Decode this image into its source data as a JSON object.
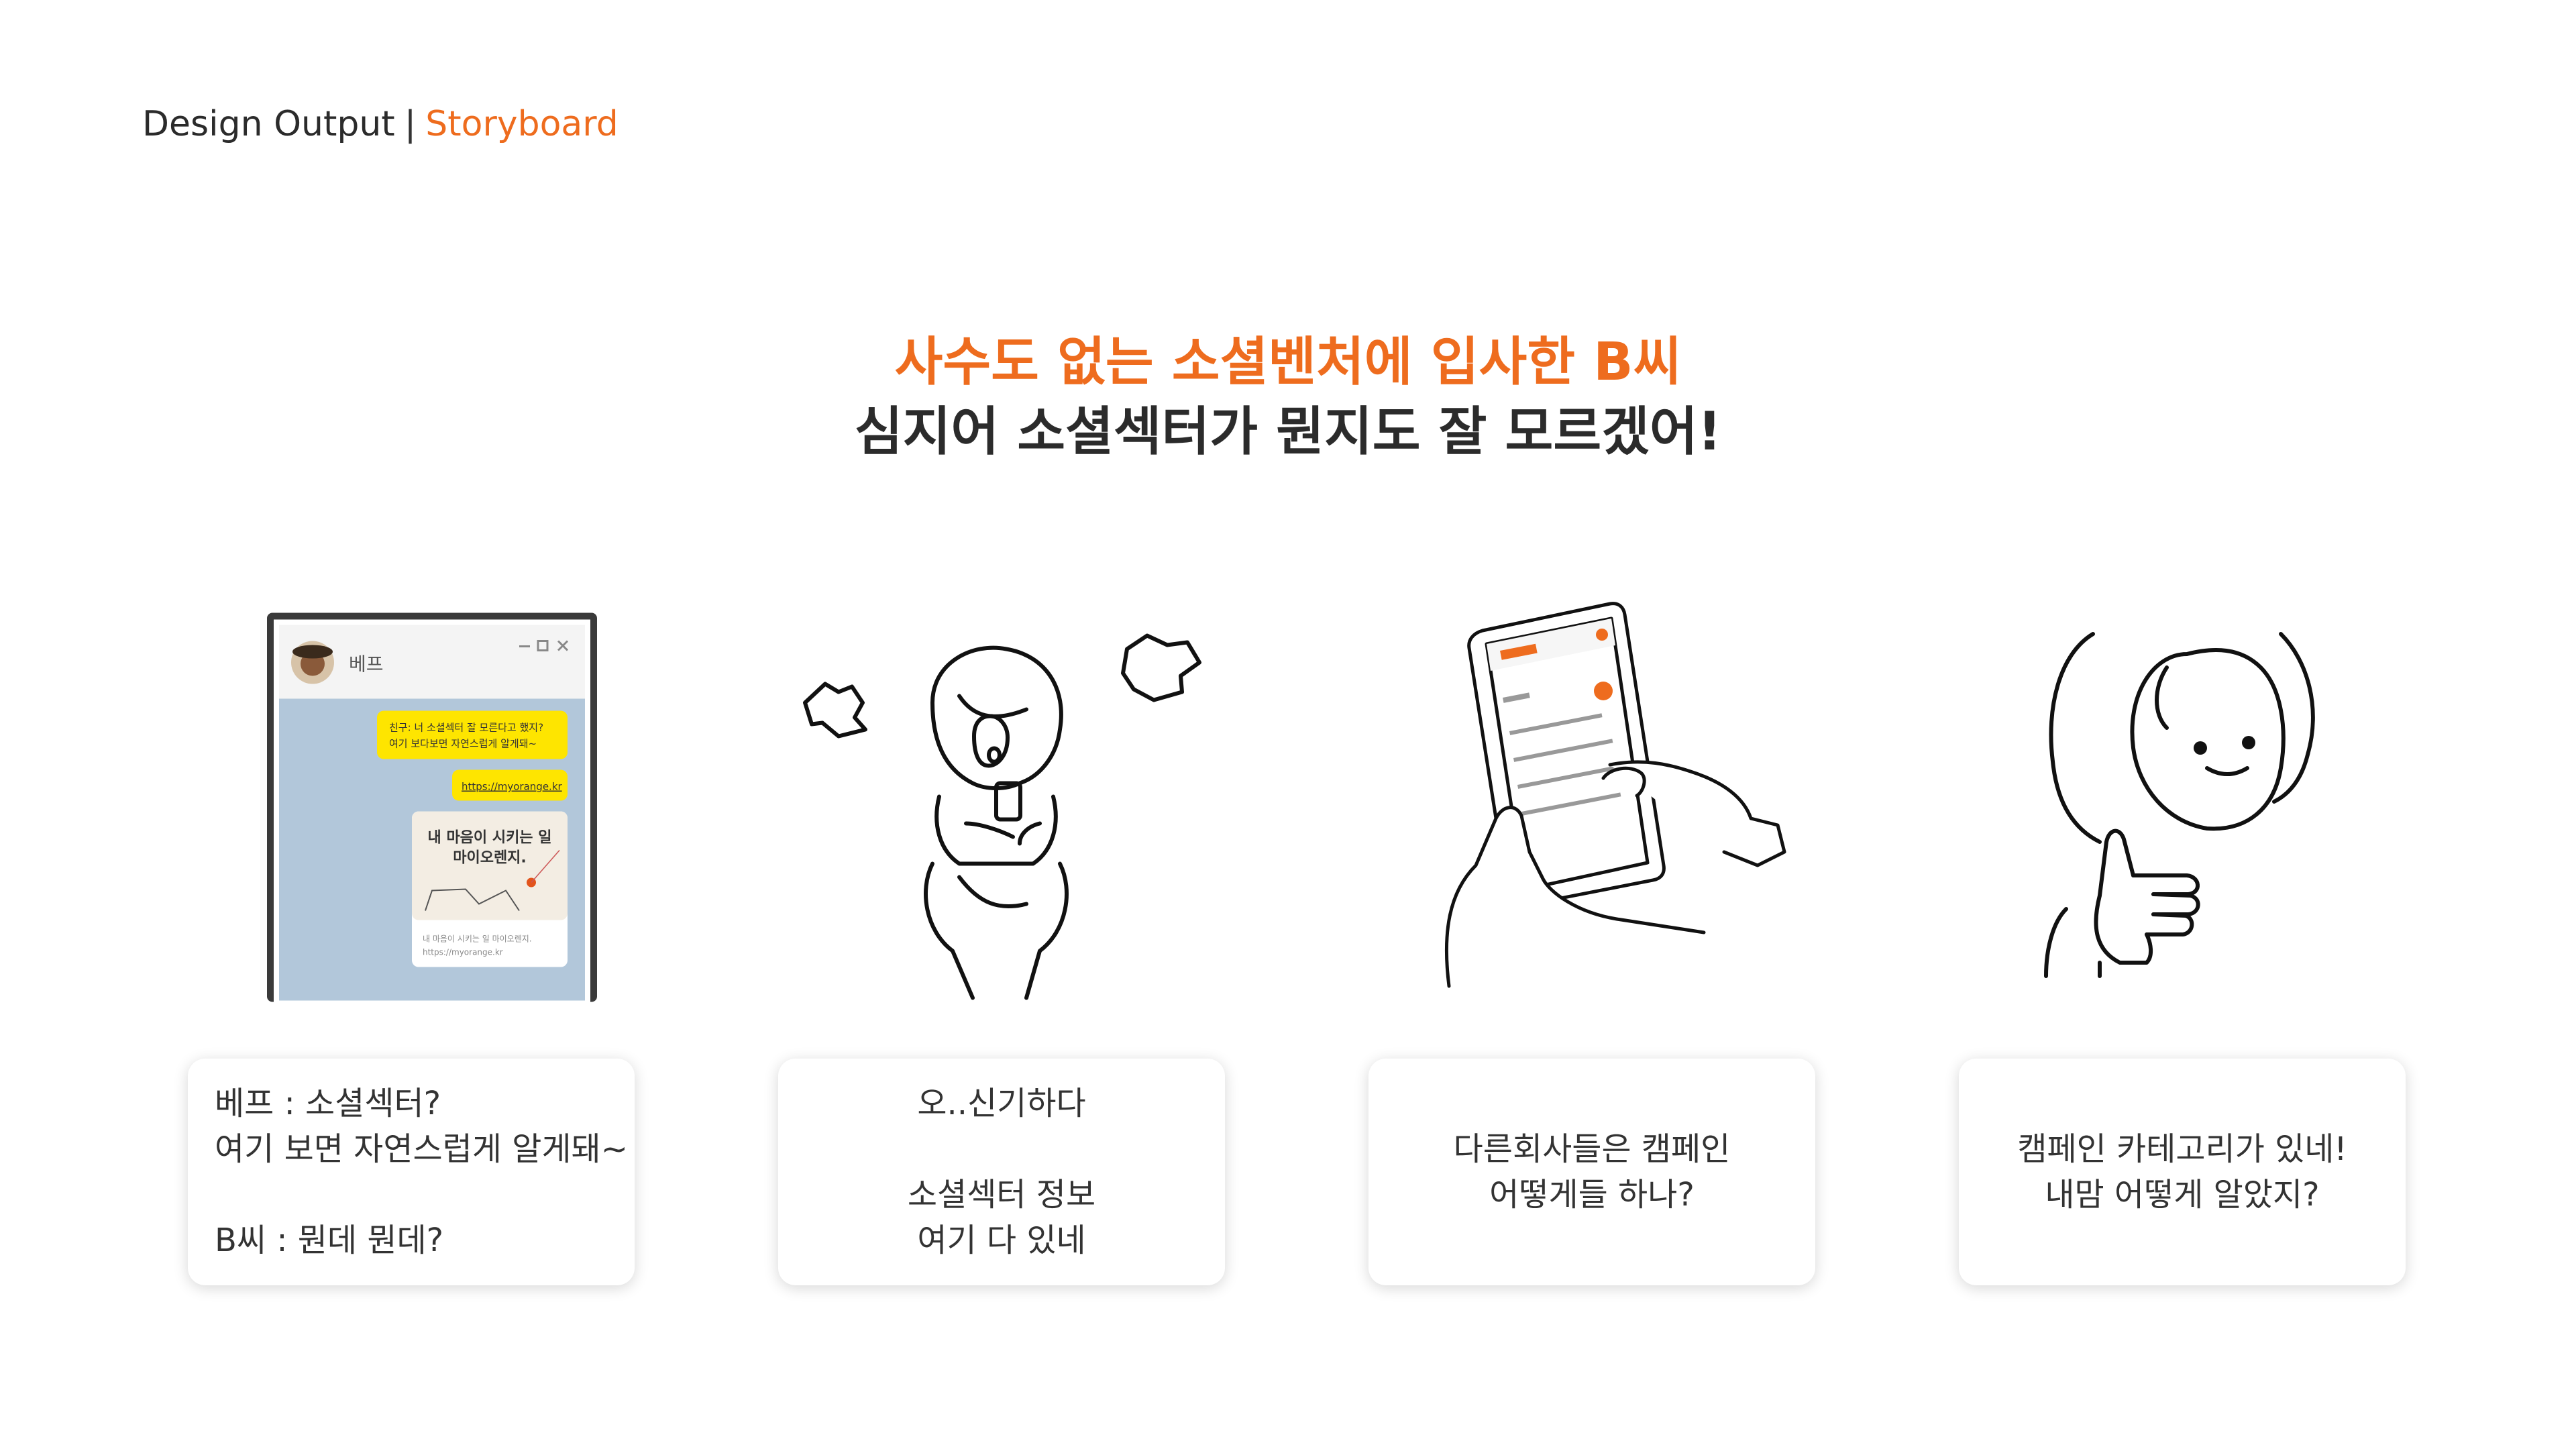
{
  "breadcrumb": {
    "section": "Design Output",
    "separator": "|",
    "current": "Storyboard"
  },
  "headline": {
    "line1": "사수도 없는 소셜벤처에 입사한 B씨",
    "line2": "심지어 소셜섹터가 뭔지도 잘 모르겠어!"
  },
  "chat_window": {
    "contact_name": "베프",
    "bubble1_line1": "친구: 너 소셜섹터 잘 모른다고 했지?",
    "bubble1_line2": "여기 보다보면 자연스럽게 알게돼~",
    "link": "https://myorange.kr",
    "preview_title_line1": "내 마음이 시키는 일",
    "preview_title_line2": "마이오렌지.",
    "preview_desc": "내 마음이 시키는 일 마이오렌지.",
    "preview_url": "https://myorange.kr"
  },
  "cards": [
    {
      "lines": [
        "베프 : 소셜섹터?",
        "여기 보면 자연스럽게 알게돼~",
        "",
        "B씨 : 뭔데 뭔데?"
      ]
    },
    {
      "lines": [
        "오..신기하다",
        "",
        "소셜섹터 정보",
        "여기 다 있네"
      ]
    },
    {
      "lines": [
        "다른회사들은 캠페인",
        "어떻게들 하나?"
      ]
    },
    {
      "lines": [
        "캠페인 카테고리가 있네!",
        "내맘 어떻게 알았지?"
      ]
    }
  ],
  "colors": {
    "accent": "#ee6c1e",
    "text": "#2b2b2b",
    "chat_bg": "#b2c7da",
    "bubble_yellow": "#fee500"
  },
  "icons": [
    "avatar",
    "minimize-icon",
    "maximize-icon",
    "close-icon"
  ]
}
